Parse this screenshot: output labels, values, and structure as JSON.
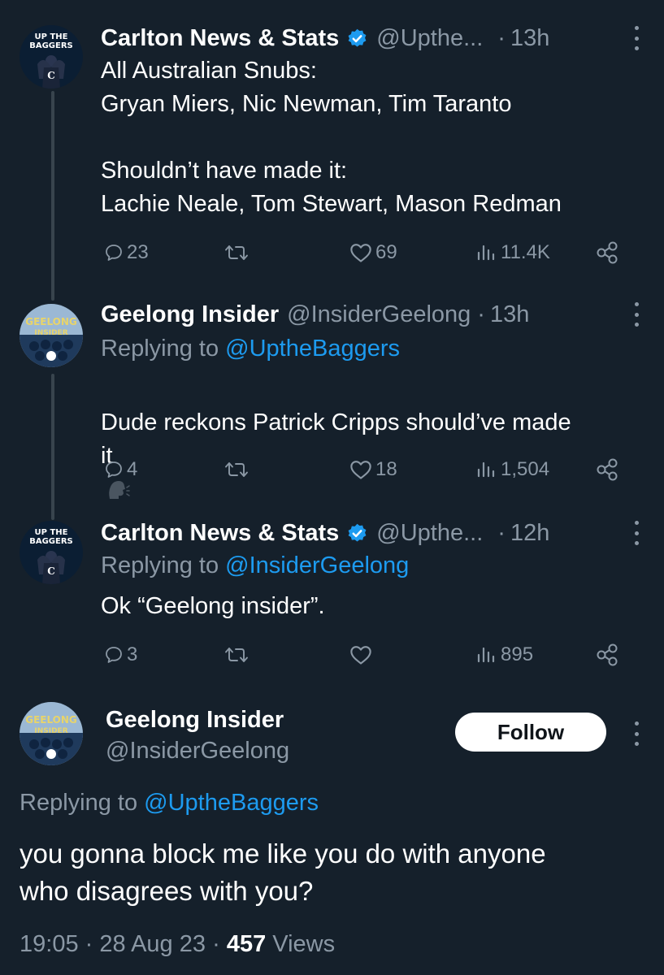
{
  "colors": {
    "background": "#15202b",
    "text": "#ffffff",
    "muted": "#8b98a5",
    "accent": "#1d9bf0",
    "thread_line": "#38444d"
  },
  "tweets": [
    {
      "name": "Carlton News & Stats",
      "verified": true,
      "handle": "@Upthe...",
      "dot": "·",
      "time": "13h",
      "avatar_text": [
        "UP THE",
        "BAGGERS"
      ],
      "text": "All Australian Snubs:\nGryan Miers, Nic Newman, Tim Taranto\n\nShouldn’t have made it:\nLachie Neale, Tom Stewart, Mason Redman",
      "replies": "23",
      "retweets": "",
      "likes": "69",
      "views": "11.4K"
    },
    {
      "name": "Geelong Insider",
      "verified": false,
      "handle": "@InsiderGeelong",
      "dot": "·",
      "time": "13h",
      "avatar_text": [
        "GEELONG",
        "INSIDER"
      ],
      "replying_prefix": "Replying to ",
      "replying_to": "@UptheBaggers",
      "text": "Dude reckons Patrick Cripps should’ve made\nit",
      "emoji_icon": "speaking-head-icon",
      "replies": "4",
      "retweets": "",
      "likes": "18",
      "views": "1,504"
    },
    {
      "name": "Carlton News & Stats",
      "verified": true,
      "handle": "@Upthe...",
      "dot": "·",
      "time": "12h",
      "avatar_text": [
        "UP THE",
        "BAGGERS"
      ],
      "replying_prefix": "Replying to ",
      "replying_to": "@InsiderGeelong",
      "text": "Ok “Geelong insider”.",
      "replies": "3",
      "retweets": "",
      "likes": "",
      "views": "895"
    }
  ],
  "main_tweet": {
    "name": "Geelong Insider",
    "handle": "@InsiderGeelong",
    "avatar_text": [
      "GEELONG",
      "INSIDER"
    ],
    "follow_label": "Follow",
    "replying_prefix": "Replying to ",
    "replying_to": "@UptheBaggers",
    "text": "you gonna block me like you do with anyone\nwho disagrees with you?",
    "time": "19:05",
    "sep1": "·",
    "date": "28 Aug 23",
    "sep2": "·",
    "views_count": "457",
    "views_label": "Views"
  }
}
